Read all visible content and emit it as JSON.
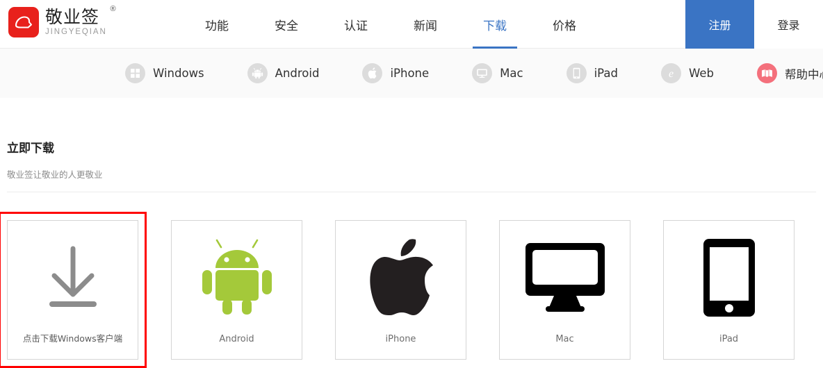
{
  "brand": {
    "cn_name": "敬业签",
    "registered_mark": "®",
    "en_name": "JINGYEQIAN",
    "logo_icon": "jingyeqian-logo-icon",
    "logo_color": "#e8211c"
  },
  "header": {
    "nav": [
      {
        "label": "功能",
        "active": false
      },
      {
        "label": "安全",
        "active": false
      },
      {
        "label": "认证",
        "active": false
      },
      {
        "label": "新闻",
        "active": false
      },
      {
        "label": "下载",
        "active": true
      },
      {
        "label": "价格",
        "active": false
      }
    ],
    "register_label": "注册",
    "login_label": "登录",
    "accent_color": "#3a74c4"
  },
  "subnav": {
    "items": [
      {
        "label": "Windows",
        "icon": "windows-icon",
        "badge": false
      },
      {
        "label": "Android",
        "icon": "android-icon",
        "badge": false
      },
      {
        "label": "iPhone",
        "icon": "apple-icon",
        "badge": false
      },
      {
        "label": "Mac",
        "icon": "monitor-icon",
        "badge": false
      },
      {
        "label": "iPad",
        "icon": "tablet-icon",
        "badge": false
      },
      {
        "label": "Web",
        "icon": "ie-browser-icon",
        "badge": false
      },
      {
        "label": "帮助中心",
        "icon": "book-icon",
        "badge": true
      }
    ],
    "help_icon_color": "#f4707c",
    "badge_color": "#e8211c"
  },
  "main": {
    "title": "立即下载",
    "subtitle": "敬业签让敬业的人更敬业"
  },
  "cards": [
    {
      "label": "点击下载Windows客户端",
      "art": "download-arrow-icon",
      "art_color": "#8c8c8c",
      "highlighted": true
    },
    {
      "label": "Android",
      "art": "android-robot-icon",
      "art_color": "#a4c93a",
      "highlighted": false
    },
    {
      "label": "iPhone",
      "art": "apple-logo-icon",
      "art_color": "#231f20",
      "highlighted": false
    },
    {
      "label": "Mac",
      "art": "imac-monitor-icon",
      "art_color": "#000000",
      "highlighted": false
    },
    {
      "label": "iPad",
      "art": "ipad-tablet-icon",
      "art_color": "#000000",
      "highlighted": false
    }
  ],
  "annotation": {
    "highlight_color": "#ff0000"
  }
}
